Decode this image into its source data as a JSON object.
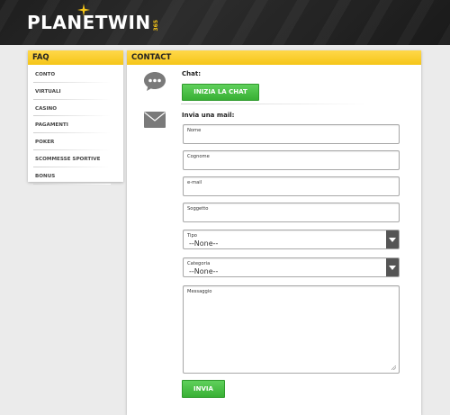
{
  "header": {
    "logo_text": "PLANETWIN",
    "logo_suffix": "365",
    "colors": {
      "brand": "#f5c518",
      "dark": "#1e1e1e"
    }
  },
  "faq": {
    "title": "FAQ",
    "items": [
      "CONTO",
      "VIRTUALI",
      "CASINO",
      "PAGAMENTI",
      "POKER",
      "SCOMMESSE SPORTIVE",
      "BONUS"
    ]
  },
  "contact": {
    "title": "CONTACT",
    "chat_label": "Chat:",
    "chat_button": "INIZIA LA CHAT",
    "mail_label": "Invia una mail:",
    "fields": {
      "name_placeholder": "Nome",
      "surname_placeholder": "Cognome",
      "email_placeholder": "e-mail",
      "subject_placeholder": "Soggetto",
      "type_label": "Tipo",
      "type_value": "--None--",
      "category_label": "Categoria",
      "category_value": "--None--",
      "message_placeholder": "Messaggio"
    },
    "send_button": "INVIA",
    "icons": {
      "chat": "chat-bubble-icon",
      "mail": "envelope-icon"
    },
    "colors": {
      "button": "#38b034"
    }
  }
}
